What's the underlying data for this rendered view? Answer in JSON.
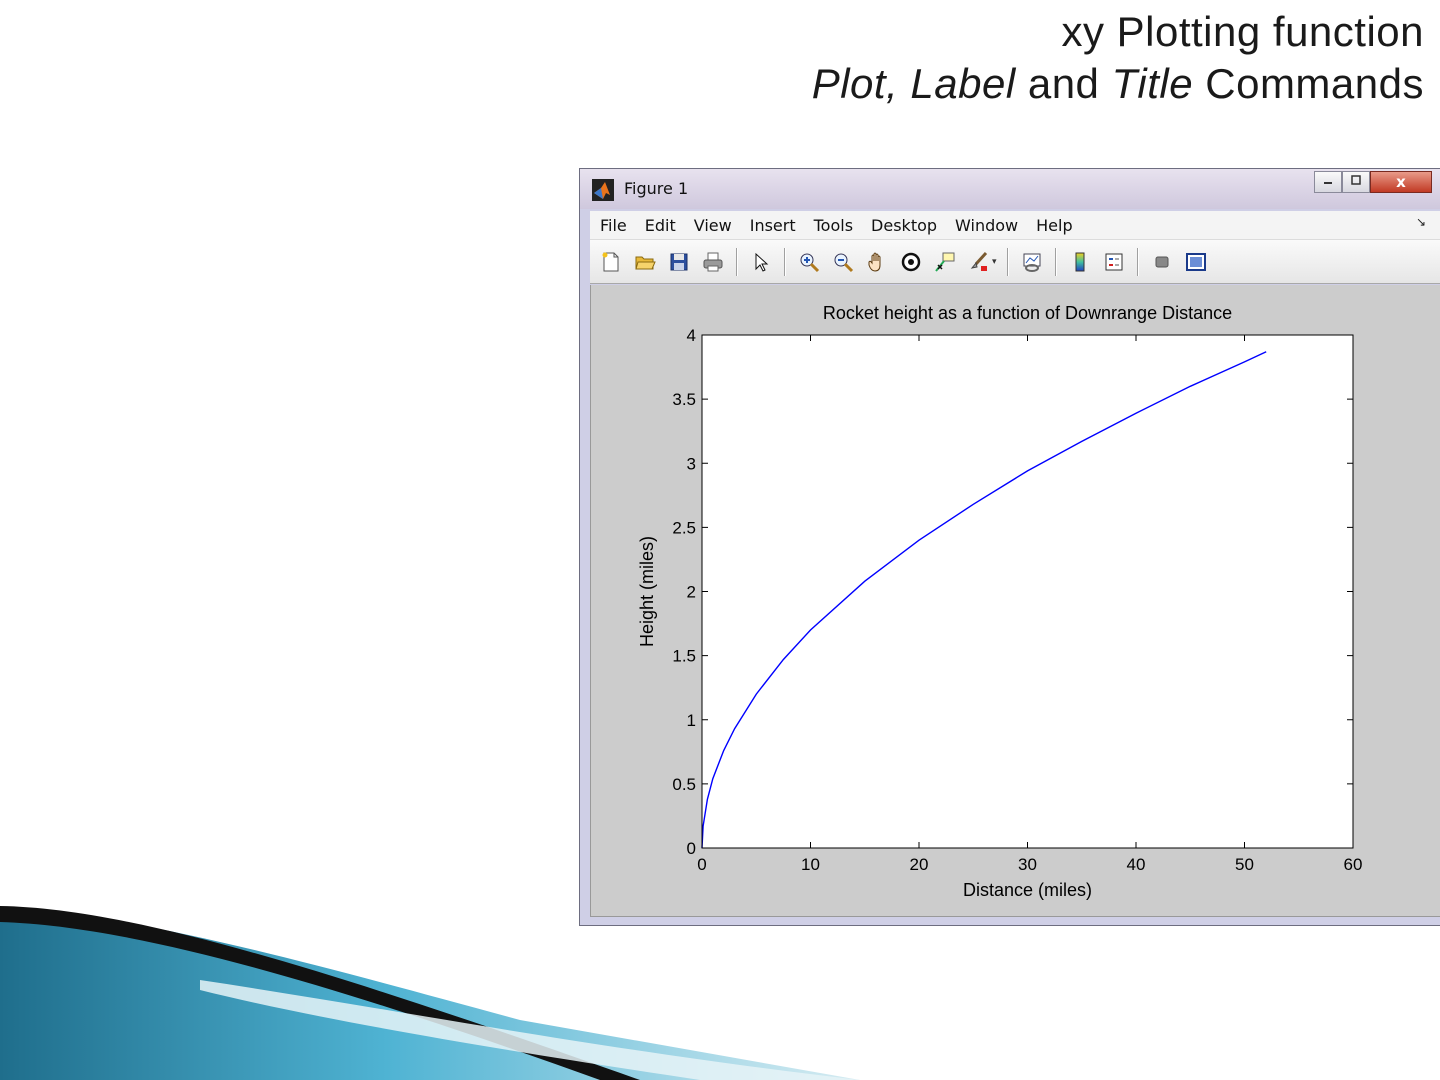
{
  "slide": {
    "title_line1": "xy Plotting function",
    "title_plot": "Plot, Label",
    "title_and": "and",
    "title_title": "Title",
    "title_commands": "Commands"
  },
  "window": {
    "title": "Figure 1",
    "close_label": "x",
    "menu": [
      "File",
      "Edit",
      "View",
      "Insert",
      "Tools",
      "Desktop",
      "Window",
      "Help"
    ],
    "toolbar_icons": [
      "new-figure-icon",
      "open-file-icon",
      "save-icon",
      "print-icon",
      "edit-plot-icon",
      "zoom-in-icon",
      "zoom-out-icon",
      "pan-icon",
      "rotate-3d-icon",
      "data-cursor-icon",
      "brush-icon",
      "link-plot-icon",
      "insert-colorbar-icon",
      "insert-legend-icon",
      "hide-plot-tools-icon",
      "show-plot-tools-icon"
    ]
  },
  "chart_data": {
    "type": "line",
    "title": "Rocket height as a function of Downrange Distance",
    "xlabel": "Distance (miles)",
    "ylabel": "Height (miles)",
    "xlim": [
      0,
      60
    ],
    "ylim": [
      0,
      4
    ],
    "xticks": [
      "0",
      "10",
      "20",
      "30",
      "40",
      "50",
      "60"
    ],
    "yticks": [
      "0",
      "0.5",
      "1",
      "1.5",
      "2",
      "2.5",
      "3",
      "3.5",
      "4"
    ],
    "grid": false,
    "series": [
      {
        "color": "#0000ff",
        "x": [
          0,
          0.1,
          0.5,
          1,
          2,
          3,
          5,
          7.5,
          10,
          15,
          20,
          25,
          30,
          35,
          40,
          45,
          50,
          52
        ],
        "y": [
          0,
          0.17,
          0.38,
          0.54,
          0.76,
          0.93,
          1.2,
          1.47,
          1.7,
          2.08,
          2.4,
          2.68,
          2.94,
          3.17,
          3.39,
          3.6,
          3.79,
          3.87
        ]
      }
    ]
  }
}
